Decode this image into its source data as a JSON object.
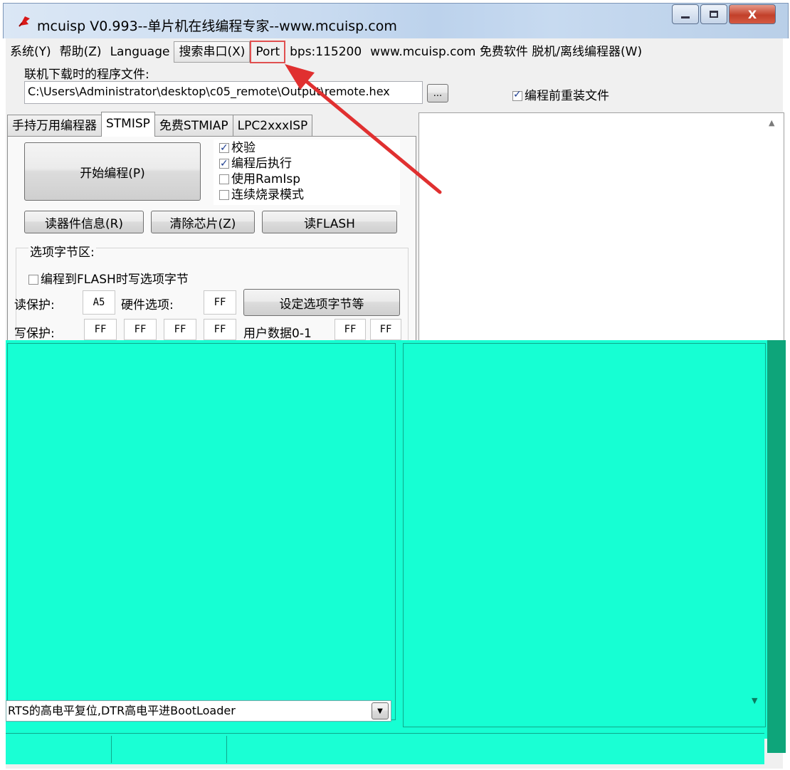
{
  "window": {
    "title": "mcuisp V0.993--单片机在线编程专家--www.mcuisp.com",
    "controls": {
      "minimize": "—",
      "maximize": "▢",
      "close": "X"
    }
  },
  "menu": {
    "system": "系统(Y)",
    "help": "帮助(Z)",
    "language": "Language",
    "search_port": "搜索串口(X)",
    "port": "Port",
    "bps": "bps:115200",
    "site": "www.mcuisp.com 免费软件 脱机/离线编程器(W)"
  },
  "file": {
    "label": "联机下载时的程序文件:",
    "path": "C:\\Users\\Administrator\\desktop\\c05_remote\\Output\\remote.hex",
    "browse": "...",
    "reload_label": "编程前重装文件",
    "reload_checked": true
  },
  "tabs": [
    "手持万用编程器",
    "STMISP",
    "免费STMIAP",
    "LPC2xxxISP"
  ],
  "active_tab": "STMISP",
  "stmisp": {
    "start_button": "开始编程(P)",
    "options": [
      {
        "label": "校验",
        "checked": true
      },
      {
        "label": "编程后执行",
        "checked": true
      },
      {
        "label": "使用RamIsp",
        "checked": false
      },
      {
        "label": "连续烧录模式",
        "checked": false
      }
    ],
    "read_info_button": "读器件信息(R)",
    "erase_button": "清除芯片(Z)",
    "read_flash_button": "读FLASH",
    "option_bytes": {
      "group_label": "选项字节区:",
      "write_opt_label": "编程到FLASH时写选项字节",
      "write_opt_checked": false,
      "read_protect_label": "读保护:",
      "read_protect_value": "A5",
      "hw_opt_label": "硬件选项:",
      "hw_opt_value": "FF",
      "set_button": "设定选项字节等",
      "write_protect_label": "写保护:",
      "write_protect_values": [
        "FF",
        "FF",
        "FF",
        "FF"
      ],
      "user_data_label": "用户数据0-1",
      "user_data_values": [
        "FF",
        "FF"
      ]
    }
  },
  "bottom": {
    "reset_mode": "RTS的高电平复位,DTR高电平进BootLoader"
  },
  "colors": {
    "annotation_red": "#e03030",
    "obscured_overlay": "#16ffd3"
  }
}
